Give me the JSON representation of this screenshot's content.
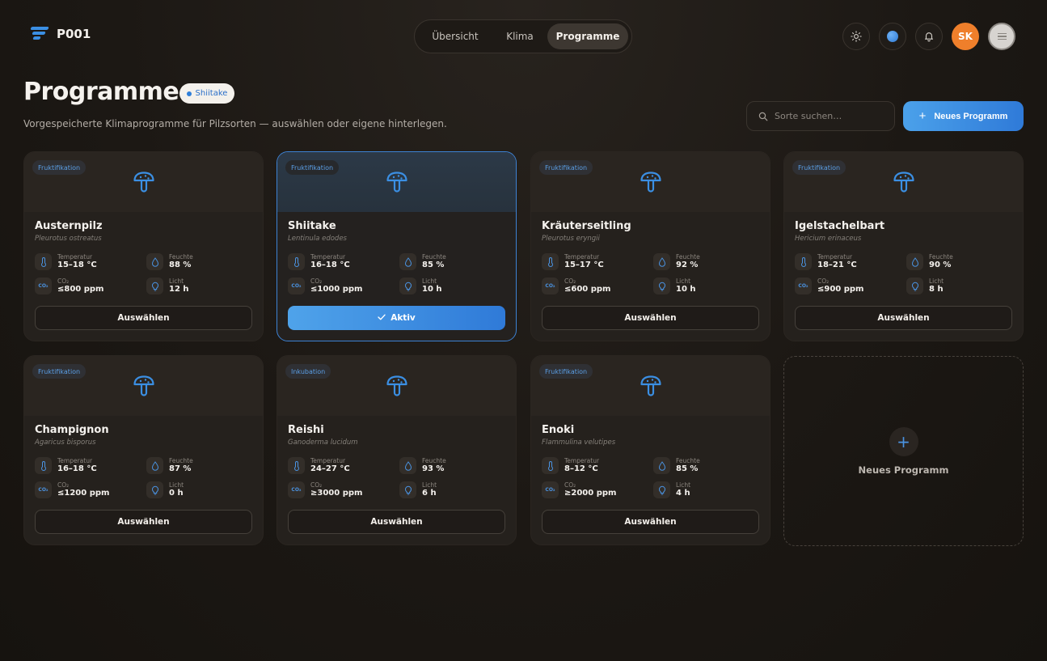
{
  "app": {
    "logo_text": "P001"
  },
  "nav": {
    "tabs": [
      "Übersicht",
      "Klima",
      "Programme"
    ],
    "active_tab": "Programme"
  },
  "header": {
    "avatar_initials": "SK"
  },
  "page": {
    "title": "Programme",
    "active_badge": "Shiitake",
    "subtitle": "Vorgespeicherte Klimaprogramme für Pilzsorten — auswählen oder eigene hinterlegen.",
    "search_placeholder": "Sorte suchen…",
    "new_button": "Neues Programm"
  },
  "labels": {
    "temp": "Temperatur",
    "hum": "Feuchte",
    "co2": "CO₂",
    "light": "Licht",
    "select": "Auswählen",
    "active": "Aktiv",
    "co2_icon": "CO₂"
  },
  "programs": [
    {
      "tag": "Fruktifikation",
      "name": "Austernpilz",
      "latin": "Pleurotus ostreatus",
      "temp": "15–18 °C",
      "hum": "88 %",
      "co2": "≤800 ppm",
      "light": "12 h",
      "active": false
    },
    {
      "tag": "Fruktifikation",
      "name": "Shiitake",
      "latin": "Lentinula edodes",
      "temp": "16–18 °C",
      "hum": "85 %",
      "co2": "≤1000 ppm",
      "light": "10 h",
      "active": true
    },
    {
      "tag": "Fruktifikation",
      "name": "Kräuterseitling",
      "latin": "Pleurotus eryngii",
      "temp": "15–17 °C",
      "hum": "92 %",
      "co2": "≤600 ppm",
      "light": "10 h",
      "active": false
    },
    {
      "tag": "Fruktifikation",
      "name": "Igelstachelbart",
      "latin": "Hericium erinaceus",
      "temp": "18–21 °C",
      "hum": "90 %",
      "co2": "≤900 ppm",
      "light": "8 h",
      "active": false
    },
    {
      "tag": "Fruktifikation",
      "name": "Champignon",
      "latin": "Agaricus bisporus",
      "temp": "16–18 °C",
      "hum": "87 %",
      "co2": "≤1200 ppm",
      "light": "0 h",
      "active": false
    },
    {
      "tag": "Inkubation",
      "name": "Reishi",
      "latin": "Ganoderma lucidum",
      "temp": "24–27 °C",
      "hum": "93 %",
      "co2": "≥3000 ppm",
      "light": "6 h",
      "active": false
    },
    {
      "tag": "Fruktifikation",
      "name": "Enoki",
      "latin": "Flammulina velutipes",
      "temp": "8–12 °C",
      "hum": "85 %",
      "co2": "≥2000 ppm",
      "light": "4 h",
      "active": false
    }
  ],
  "new_card_label": "Neues Programm",
  "colors": {
    "accent": "#3b8fe3",
    "avatar": "#ef7f2b",
    "background": "#1c1814"
  }
}
